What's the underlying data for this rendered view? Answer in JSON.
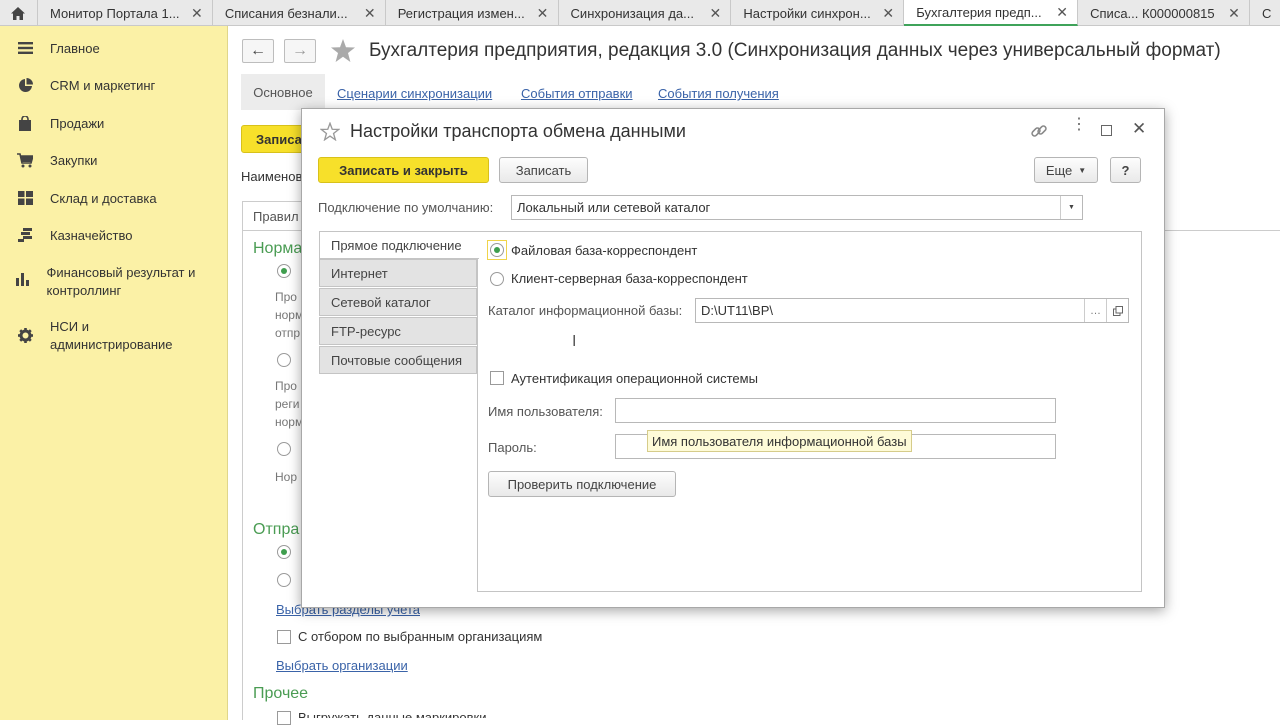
{
  "tabs": [
    {
      "label": "Монитор Портала 1..."
    },
    {
      "label": "Списания безнали..."
    },
    {
      "label": "Регистрация измен..."
    },
    {
      "label": "Синхронизация да..."
    },
    {
      "label": "Настройки синхрон..."
    },
    {
      "label": "Бухгалтерия предп..."
    },
    {
      "label": "Списа... К000000815"
    },
    {
      "label": "С"
    }
  ],
  "sidebar": {
    "items": [
      {
        "label": "Главное",
        "icon": "menu-icon"
      },
      {
        "label": "CRM и маркетинг",
        "icon": "pie-chart-icon"
      },
      {
        "label": "Продажи",
        "icon": "shopping-bag-icon"
      },
      {
        "label": "Закупки",
        "icon": "cart-icon"
      },
      {
        "label": "Склад и доставка",
        "icon": "warehouse-icon"
      },
      {
        "label": "Казначейство",
        "icon": "coins-icon"
      },
      {
        "label": "Финансовый результат и контроллинг",
        "icon": "bar-chart-icon"
      },
      {
        "label": "НСИ и администрирование",
        "icon": "gear-icon"
      }
    ]
  },
  "main": {
    "title": "Бухгалтерия предприятия, редакция 3.0 (Синхронизация данных через универсальный формат)",
    "nav_tabs": [
      "Основное",
      "Сценарии синхронизации",
      "События отправки",
      "События получения"
    ],
    "save_button": "Записать",
    "name_label": "Наименов",
    "subtab": "Правил",
    "section_norm": "Норма",
    "section_send": "Отпра",
    "snippets": {
      "a1": "Про",
      "a2": "норм",
      "a3": "отпр",
      "b1": "Про",
      "b2": "реги",
      "b3": "норм",
      "c1": "Нор"
    },
    "select_sections_link": "Выбрать разделы учета",
    "filter_checkbox": "С отбором по выбранным организациям",
    "select_orgs_link": "Выбрать организации",
    "section_other": "Прочее",
    "unload_checkbox": "Выгружать данные маркировки"
  },
  "dialog": {
    "title": "Настройки транспорта обмена данными",
    "save_close": "Записать и закрыть",
    "save": "Записать",
    "more": "Еще",
    "help": "?",
    "default_conn_label": "Подключение по умолчанию:",
    "default_conn_value": "Локальный или сетевой каталог",
    "vtabs": [
      "Прямое подключение",
      "Интернет",
      "Сетевой каталог",
      "FTP-ресурс",
      "Почтовые сообщения"
    ],
    "radio_file": "Файловая база-корреспондент",
    "radio_server": "Клиент-серверная база-корреспондент",
    "catalog_label": "Каталог информационной базы:",
    "catalog_value": "D:\\UT11\\BP\\",
    "os_auth": "Аутентификация операционной системы",
    "user_label": "Имя пользователя:",
    "password_label": "Пароль:",
    "tooltip": "Имя пользователя информационной базы",
    "check_button": "Проверить подключение"
  }
}
